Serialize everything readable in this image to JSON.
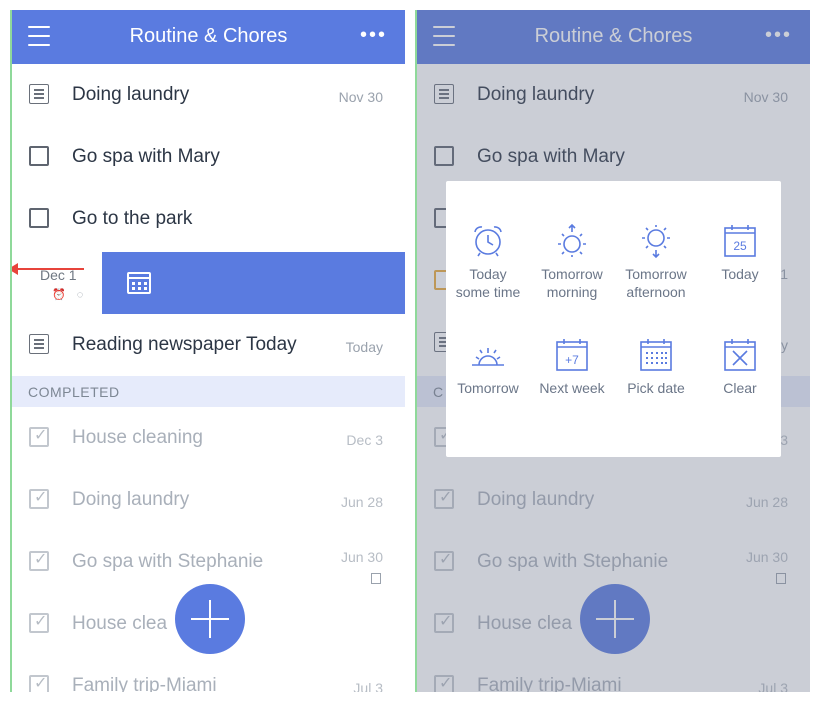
{
  "app": {
    "title": "Routine & Chores",
    "more_label": "•••"
  },
  "colors": {
    "accent": "#5a7be0",
    "section_bg": "#e6ebfb",
    "swipe_arrow": "#e7443b"
  },
  "left": {
    "tasks": [
      {
        "label": "Doing laundry",
        "date": "Nov 30",
        "icon": "note-icon"
      },
      {
        "label": "Go spa with Mary",
        "date": "",
        "icon": "checkbox"
      },
      {
        "label": "Go to the park",
        "date": "",
        "icon": "checkbox"
      },
      {
        "label": "Reading newspaper Today",
        "date": "Today",
        "icon": "note-icon"
      }
    ],
    "swipe": {
      "date": "Dec 1",
      "reminder_glyphs": "⏰ ◌"
    },
    "completed_header": "COMPLETED",
    "completed": [
      {
        "label": "House cleaning",
        "date": "Dec 3"
      },
      {
        "label": "Doing laundry",
        "date": "Jun 28"
      },
      {
        "label": "Go spa with Stephanie",
        "date": "Jun 30"
      },
      {
        "label": "House clea",
        "date": ""
      },
      {
        "label": "Family trip-Miami",
        "date": "Jul 3"
      }
    ]
  },
  "right": {
    "tasks": [
      {
        "label": "Doing laundry",
        "date": "Nov 30"
      },
      {
        "label": "Go spa with Mary",
        "date": ""
      }
    ],
    "side_fragments": {
      "row3_right": "1",
      "row4_right": "y",
      "row5_right": "3",
      "section_left": "C"
    },
    "completed": [
      {
        "label": "Doing laundry",
        "date": "Jun 28"
      },
      {
        "label": "Go spa with Stephanie",
        "date": "Jun 30"
      },
      {
        "label": "House clea",
        "date": ""
      },
      {
        "label": "Family trip-Miami",
        "date": "Jul 3"
      }
    ]
  },
  "picker": {
    "options": [
      {
        "label1": "Today",
        "label2": "some time",
        "icon": "alarm-clock-icon"
      },
      {
        "label1": "Tomorrow",
        "label2": "morning",
        "icon": "sunrise-icon"
      },
      {
        "label1": "Tomorrow",
        "label2": "afternoon",
        "icon": "sun-down-icon"
      },
      {
        "label1": "Today",
        "label2": "",
        "icon": "calendar-today-icon",
        "badge": "25"
      },
      {
        "label1": "Tomorrow",
        "label2": "",
        "icon": "horizon-sun-icon"
      },
      {
        "label1": "Next week",
        "label2": "",
        "icon": "calendar-plus7-icon",
        "badge": "+7"
      },
      {
        "label1": "Pick date",
        "label2": "",
        "icon": "calendar-grid-icon"
      },
      {
        "label1": "Clear",
        "label2": "",
        "icon": "clear-x-icon"
      }
    ]
  }
}
